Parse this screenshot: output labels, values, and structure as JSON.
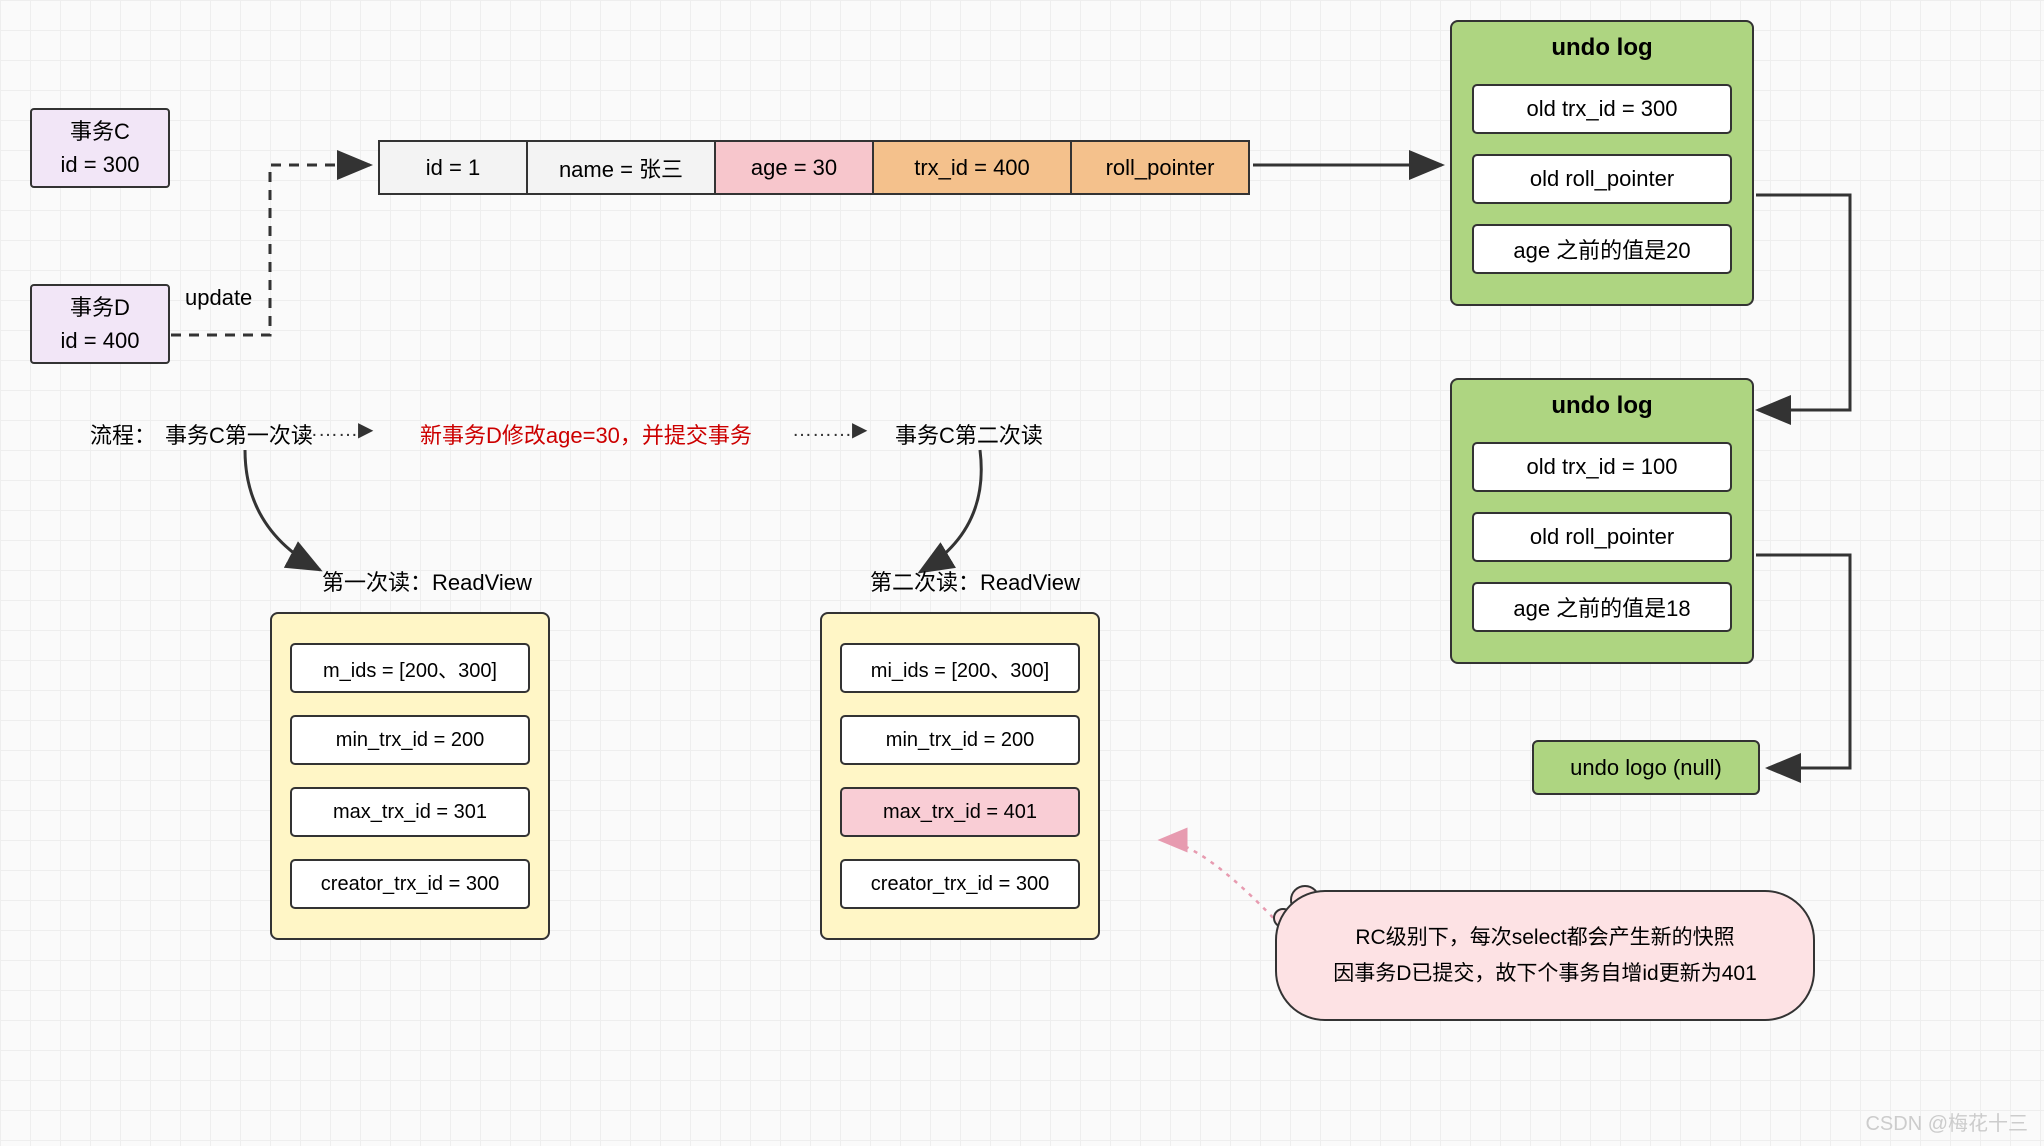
{
  "tx_c": {
    "line1": "事务C",
    "line2": "id = 300"
  },
  "tx_d": {
    "line1": "事务D",
    "line2": "id = 400"
  },
  "update": "update",
  "row": {
    "id": "id = 1",
    "name": "name = 张三",
    "age": "age = 30",
    "trx": "trx_id = 400",
    "rp": "roll_pointer"
  },
  "undo1": {
    "title": "undo log",
    "a": "old trx_id = 300",
    "b": "old roll_pointer",
    "c": "age 之前的值是20"
  },
  "undo2": {
    "title": "undo log",
    "a": "old trx_id = 100",
    "b": "old roll_pointer",
    "c": "age 之前的值是18"
  },
  "undo_null": "undo logo (null)",
  "flow": {
    "prefix": "流程：",
    "step1": "事务C第一次读",
    "step2": "新事务D修改age=30，并提交事务",
    "step3": "事务C第二次读"
  },
  "rv1": {
    "title": "第一次读：ReadView",
    "m_ids": "m_ids = [200、300]",
    "min": "min_trx_id = 200",
    "max": "max_trx_id = 301",
    "creator": "creator_trx_id = 300"
  },
  "rv2": {
    "title": "第二次读：ReadView",
    "m_ids": "mi_ids = [200、300]",
    "min": "min_trx_id = 200",
    "max": "max_trx_id = 401",
    "creator": "creator_trx_id = 300"
  },
  "cloud": {
    "line1": "RC级别下，每次select都会产生新的快照",
    "line2": "因事务D已提交，故下个事务自增id更新为401"
  },
  "watermark": "CSDN @梅花十三"
}
